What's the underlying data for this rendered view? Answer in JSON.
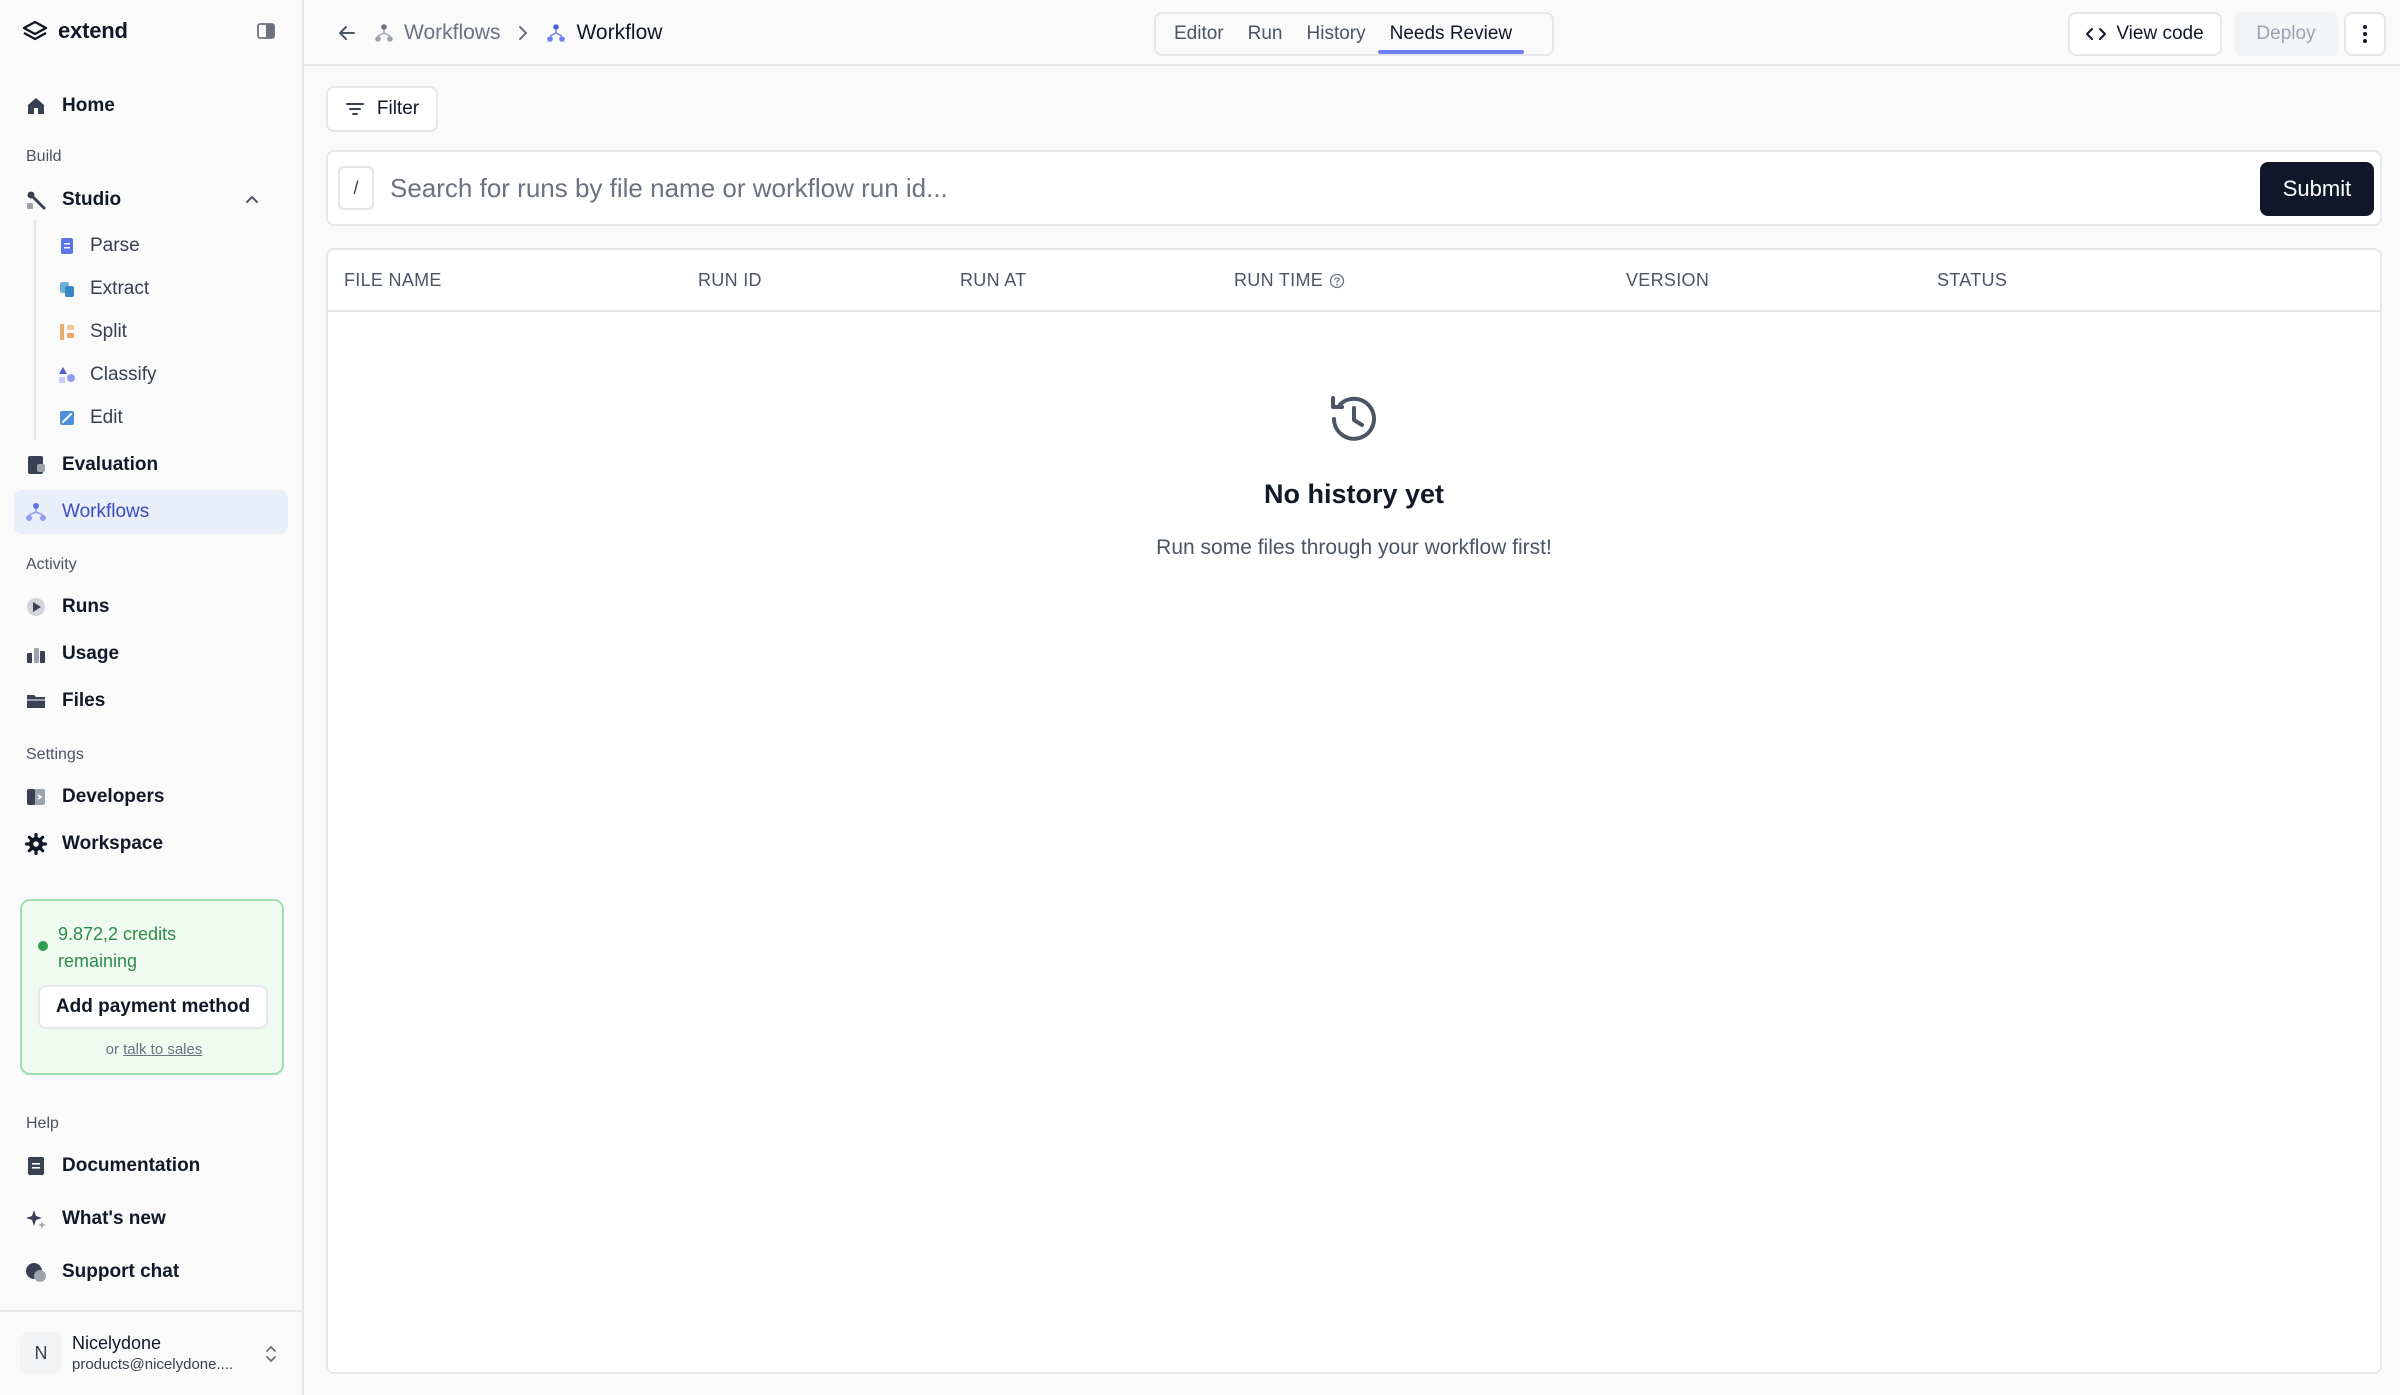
{
  "brand": {
    "name": "extend"
  },
  "sidebar": {
    "home": "Home",
    "build_label": "Build",
    "studio": "Studio",
    "studio_items": [
      "Parse",
      "Extract",
      "Split",
      "Classify",
      "Edit"
    ],
    "evaluation": "Evaluation",
    "workflows": "Workflows",
    "activity_label": "Activity",
    "runs": "Runs",
    "usage": "Usage",
    "files": "Files",
    "settings_label": "Settings",
    "developers": "Developers",
    "workspace": "Workspace",
    "credits": {
      "text": "9.872,2 credits remaining",
      "add_payment": "Add payment method",
      "or": "or",
      "talk_to_sales": "talk to sales"
    },
    "help_label": "Help",
    "documentation": "Documentation",
    "whats_new": "What's new",
    "support_chat": "Support chat",
    "user": {
      "initial": "N",
      "name": "Nicelydone",
      "email": "products@nicelydone...."
    }
  },
  "header": {
    "breadcrumb_parent": "Workflows",
    "breadcrumb_current": "Workflow",
    "tabs": [
      "Editor",
      "Run",
      "History",
      "Needs Review"
    ],
    "active_tab": "Needs Review",
    "view_code": "View code",
    "deploy": "Deploy"
  },
  "toolbar": {
    "filter": "Filter",
    "search_shortcut": "/",
    "search_placeholder": "Search for runs by file name or workflow run id...",
    "submit": "Submit"
  },
  "table": {
    "columns": [
      "FILE NAME",
      "RUN ID",
      "RUN AT",
      "RUN TIME",
      "VERSION",
      "STATUS"
    ]
  },
  "empty_state": {
    "title": "No history yet",
    "subtitle": "Run some files through your workflow first!"
  },
  "colors": {
    "accent": "#3b4cc0",
    "active_nav_bg": "#eaeefb",
    "tab_underline": "#6d7ff0",
    "submit_bg": "#0f1729",
    "credits_green": "#2e8b4a"
  }
}
